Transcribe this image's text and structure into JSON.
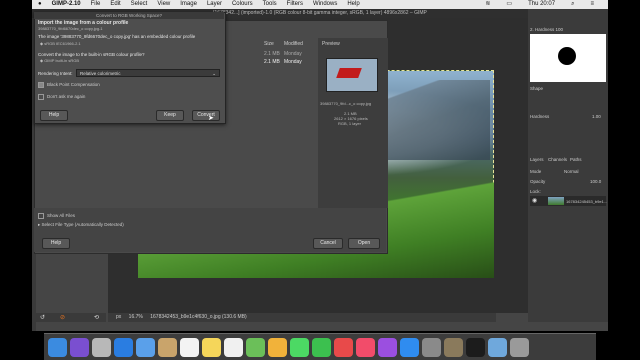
{
  "menubar": {
    "apple": "",
    "items": [
      "GIMP-2.10",
      "File",
      "Edit",
      "Select",
      "View",
      "Image",
      "Layer",
      "Colours",
      "Tools",
      "Filters",
      "Windows",
      "Help"
    ],
    "time": "Thu 20:07"
  },
  "window": {
    "title": "[1678342...] (imported)-1.0 (RGB colour 8-bit gamma integer, sRGB, 1 layer) 4896x2862 – GIMP"
  },
  "convert_dialog": {
    "window_title": "Convert to RGB Working Space?",
    "heading": "Import the image from a colour profile",
    "subheading": "39883770_9fd6670dec_o copy.jpg-1",
    "message": "The image '39883770_9fd6670dec_o copy.jpg' has an embedded colour profile",
    "profile": "sRGB IEC61966-2.1",
    "question": "Convert the image to the built-in sRGB colour profile?",
    "builtin": "GIMP built-in sRGB",
    "intent_label": "Rendering Intent:",
    "intent_value": "Relative colorimetric",
    "black_point": "Black Point Compensation",
    "dont_ask": "Don't ask me again",
    "help": "Help",
    "keep": "Keep",
    "convert": "Convert"
  },
  "open_dialog": {
    "col_size": "Size",
    "col_modified": "Modified",
    "rows": [
      {
        "size": "2.1 MB",
        "modified": "Monday"
      },
      {
        "size": "2.1 MB",
        "modified": "Monday"
      }
    ],
    "preview_label": "Preview",
    "preview_name": "39883770_9fd...c_o copy.jpg",
    "preview_info1": "2.1 MB",
    "preview_info2": "2612 × 1676 pixels",
    "preview_info3": "RGB, 1 layer",
    "show_all_files": "Show All Files",
    "select_file_type": "Select File Type (Automatically Detected)",
    "help": "Help",
    "cancel": "Cancel",
    "open": "Open"
  },
  "right_dock": {
    "brush_name": "2. Hardness 100",
    "shape_label": "Shape",
    "hardness_label": "Hardness",
    "hardness_value": "1.00",
    "tabs": [
      "Layers",
      "Channels",
      "Paths"
    ],
    "mode_label": "Mode",
    "mode_value": "Normal",
    "opacity_label": "Opacity",
    "opacity_value": "100.0",
    "lock_label": "Lock:",
    "layer_name": "167834245453_b9e1..."
  },
  "status": {
    "unit": "px",
    "zoom": "16.7%",
    "info": "1678342453_b9e1c4f630_o.jpg (130.6 MB)"
  },
  "dock_icons": [
    {
      "name": "finder-icon",
      "color": "#3b8be0"
    },
    {
      "name": "siri-icon",
      "color": "#7a4fd0"
    },
    {
      "name": "launchpad-icon",
      "color": "#b8b8b8"
    },
    {
      "name": "safari-icon",
      "color": "#2a7de1"
    },
    {
      "name": "mail-icon",
      "color": "#5aa0ea"
    },
    {
      "name": "contacts-icon",
      "color": "#c9a46b"
    },
    {
      "name": "calendar-icon",
      "color": "#f3f3f3"
    },
    {
      "name": "notes-icon",
      "color": "#f5d65a"
    },
    {
      "name": "reminders-icon",
      "color": "#f0f0f0"
    },
    {
      "name": "maps-icon",
      "color": "#6bbf59"
    },
    {
      "name": "photos-icon",
      "color": "#f1b23a"
    },
    {
      "name": "messages-icon",
      "color": "#4cd964"
    },
    {
      "name": "facetime-icon",
      "color": "#3cc04f"
    },
    {
      "name": "news-icon",
      "color": "#e84a4a"
    },
    {
      "name": "music-icon",
      "color": "#f24c6a"
    },
    {
      "name": "podcasts-icon",
      "color": "#9b4fe0"
    },
    {
      "name": "appstore-icon",
      "color": "#2f8cf0"
    },
    {
      "name": "preferences-icon",
      "color": "#8a8a8a"
    },
    {
      "name": "gimp-icon",
      "color": "#8a7a5c"
    },
    {
      "name": "quicktime-icon",
      "color": "#1c1c1c"
    },
    {
      "name": "folder-icon",
      "color": "#6fa8dc"
    },
    {
      "name": "trash-icon",
      "color": "#9a9a9a"
    }
  ]
}
